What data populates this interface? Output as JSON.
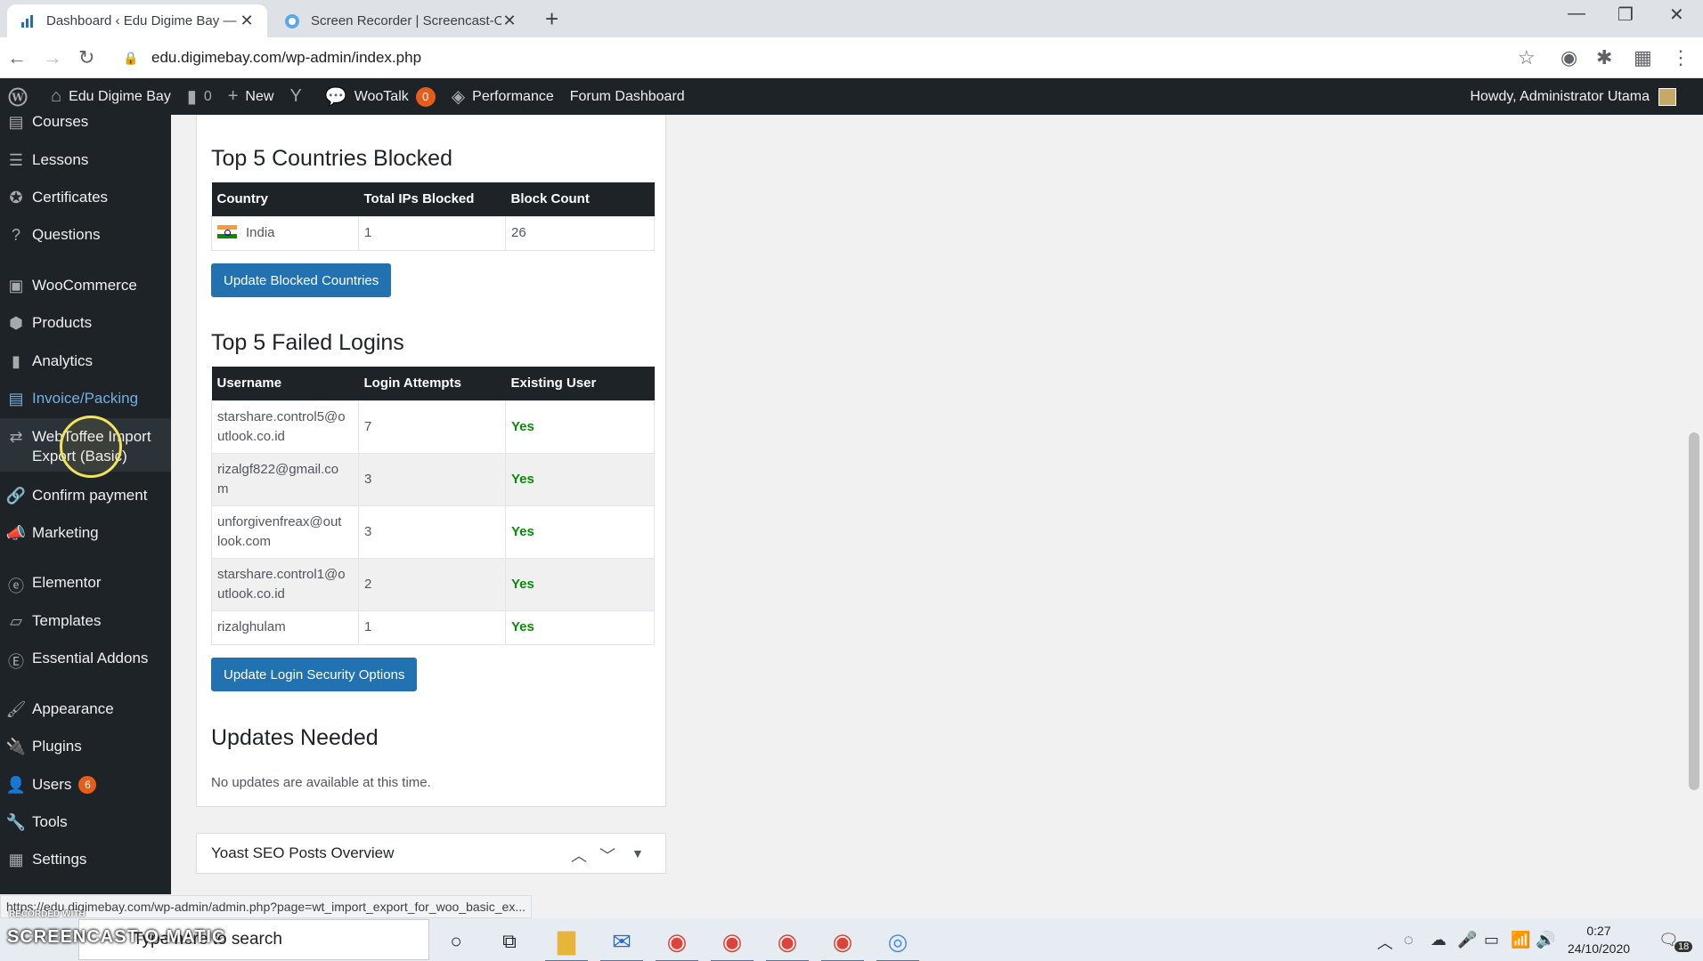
{
  "browser": {
    "tabs": [
      {
        "title": "Dashboard ‹ Edu Digime Bay — W",
        "close": "✕"
      },
      {
        "title": "Screen Recorder | Screencast-O-M",
        "close": "✕"
      }
    ],
    "new_tab": "+",
    "url": "edu.digimebay.com/wp-admin/index.php",
    "status_url": "https://edu.digimebay.com/wp-admin/admin.php?page=wt_import_export_for_woo_basic_ex..."
  },
  "adminbar": {
    "site_name": "Edu Digime Bay",
    "comments_count": "0",
    "new_label": "New",
    "wootalk_label": "WooTalk",
    "wootalk_count": "0",
    "performance_label": "Performance",
    "forum_label": "Forum Dashboard",
    "howdy": "Howdy, Administrator Utama"
  },
  "sidebar": {
    "items": [
      {
        "label": "Courses",
        "icon": "courses-icon"
      },
      {
        "label": "Lessons",
        "icon": "lessons-icon"
      },
      {
        "label": "Certificates",
        "icon": "certificates-icon"
      },
      {
        "label": "Questions",
        "icon": "questions-icon"
      },
      {
        "label": "WooCommerce",
        "icon": "woocommerce-icon"
      },
      {
        "label": "Products",
        "icon": "products-icon"
      },
      {
        "label": "Analytics",
        "icon": "analytics-icon"
      },
      {
        "label": "Invoice/Packing",
        "icon": "invoice-icon"
      },
      {
        "label": "WebToffee Import Export (Basic)",
        "icon": "import-export-icon"
      },
      {
        "label": "Confirm payment",
        "icon": "confirm-payment-icon"
      },
      {
        "label": "Marketing",
        "icon": "marketing-icon"
      },
      {
        "label": "Elementor",
        "icon": "elementor-icon"
      },
      {
        "label": "Templates",
        "icon": "templates-icon"
      },
      {
        "label": "Essential Addons",
        "icon": "essential-addons-icon"
      },
      {
        "label": "Appearance",
        "icon": "appearance-icon"
      },
      {
        "label": "Plugins",
        "icon": "plugins-icon"
      },
      {
        "label": "Users",
        "icon": "users-icon",
        "badge": "6"
      },
      {
        "label": "Tools",
        "icon": "tools-icon"
      },
      {
        "label": "Settings",
        "icon": "settings-icon"
      }
    ]
  },
  "countries": {
    "title": "Top 5 Countries Blocked",
    "headers": [
      "Country",
      "Total IPs Blocked",
      "Block Count"
    ],
    "rows": [
      {
        "country": "India",
        "ips": "1",
        "count": "26"
      }
    ],
    "button": "Update Blocked Countries"
  },
  "logins": {
    "title": "Top 5 Failed Logins",
    "headers": [
      "Username",
      "Login Attempts",
      "Existing User"
    ],
    "rows": [
      {
        "user_l1": "starshare.control5@o",
        "user_l2": "utlook.co.id",
        "attempts": "7",
        "existing": "Yes"
      },
      {
        "user_l1": "rizalgf822@gmail.co",
        "user_l2": "m",
        "attempts": "3",
        "existing": "Yes"
      },
      {
        "user_l1": "unforgivenfreax@out",
        "user_l2": "look.com",
        "attempts": "3",
        "existing": "Yes"
      },
      {
        "user_l1": "starshare.control1@o",
        "user_l2": "utlook.co.id",
        "attempts": "2",
        "existing": "Yes"
      },
      {
        "user_l1": "rizalghulam",
        "user_l2": "",
        "attempts": "1",
        "existing": "Yes"
      }
    ],
    "button": "Update Login Security Options"
  },
  "updates": {
    "title": "Updates Needed",
    "note": "No updates are available at this time."
  },
  "yoast": {
    "title": "Yoast SEO Posts Overview"
  },
  "taskbar": {
    "search_placeholder": "Type here to search",
    "watermark": "SCREENCAST-O-MATIC",
    "watermark_small": "RECORDED WITH",
    "time": "0:27",
    "date": "24/10/2020",
    "notification_count": "18"
  },
  "colors": {
    "wp_dark": "#1d2327",
    "wp_blue": "#2271b1",
    "badge_orange": "#e65d1a",
    "yes_green": "#0a8a0a",
    "current_link": "#72aee6"
  }
}
